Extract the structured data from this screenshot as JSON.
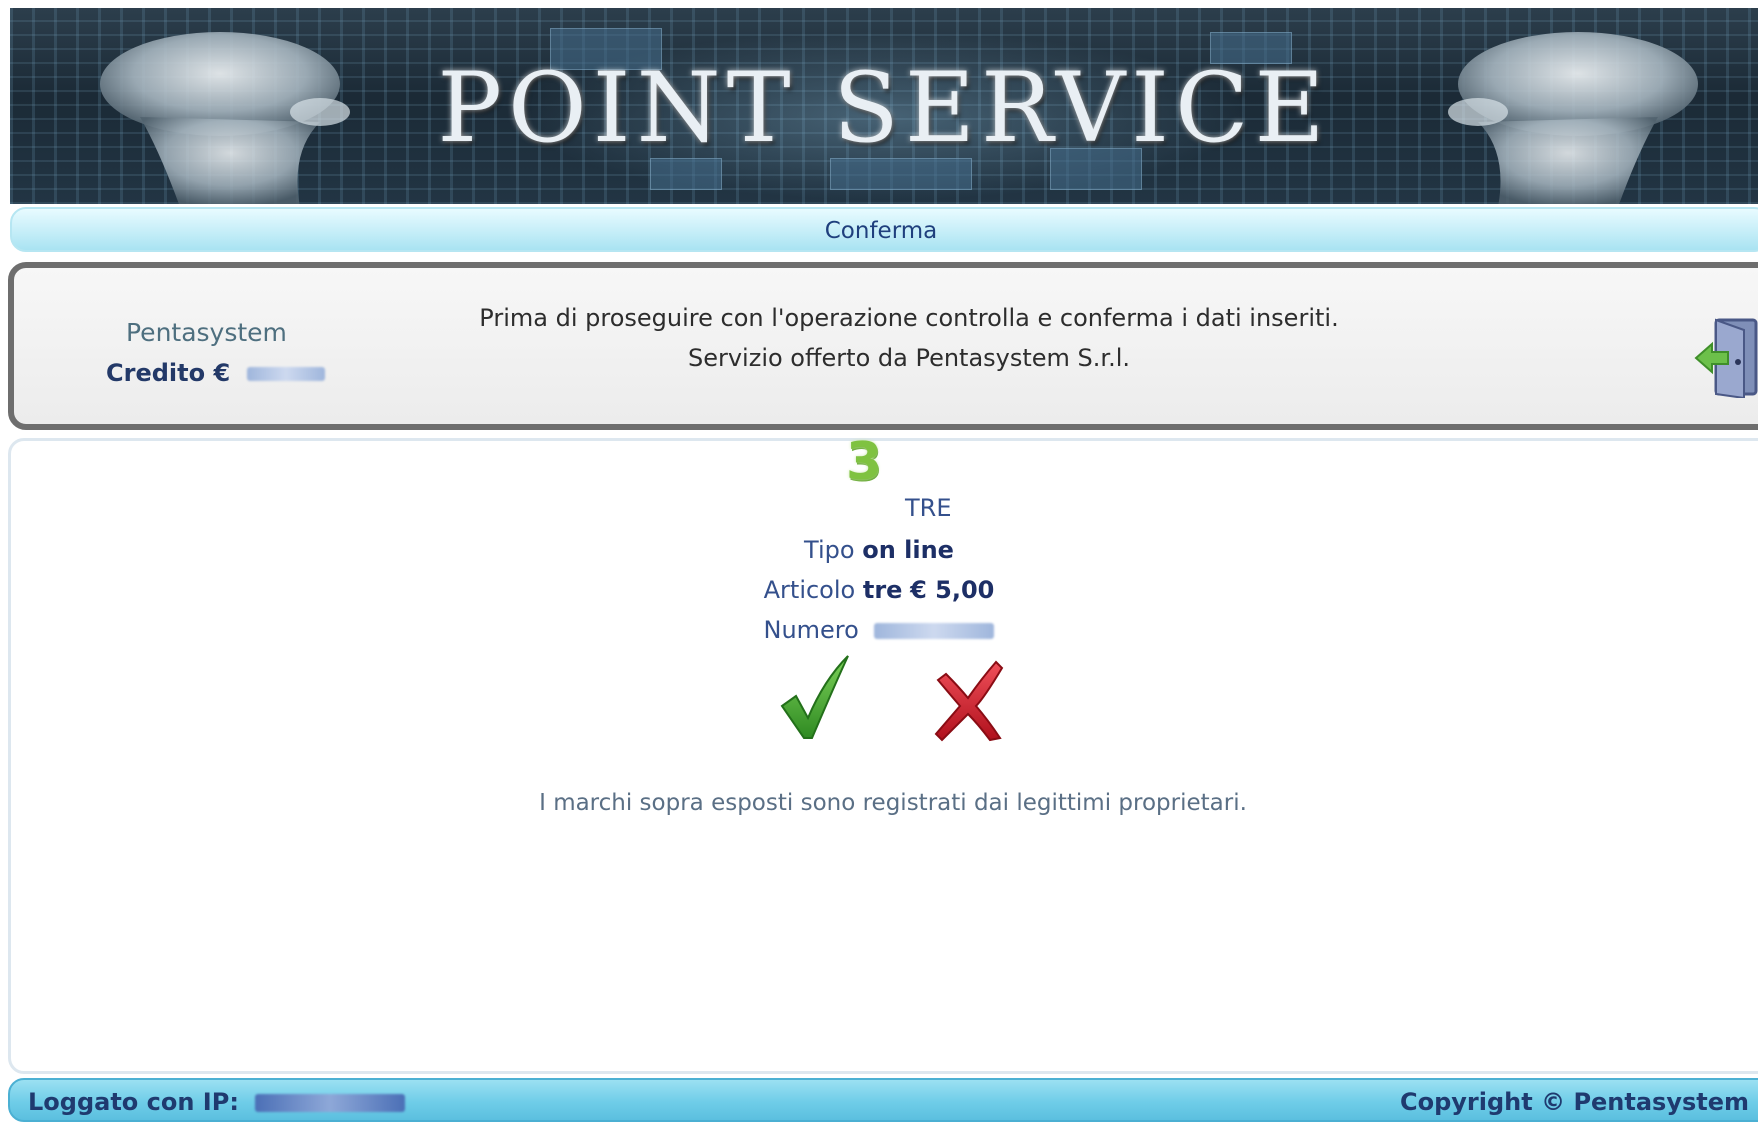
{
  "banner": {
    "title": "POINT SERVICE"
  },
  "title_bar": {
    "label": "Conferma"
  },
  "info": {
    "brand": "Pentasystem",
    "credit_label": "Credito €",
    "message_line1": "Prima di proseguire con l'operazione controlla e conferma i dati inseriti.",
    "message_line2": "Servizio offerto da Pentasystem S.r.l.",
    "logout_icon": "logout-door-icon"
  },
  "operator": {
    "logo_text": "3",
    "name": "TRE"
  },
  "details": {
    "tipo_label": "Tipo",
    "tipo_value": "on line",
    "articolo_label": "Articolo",
    "articolo_value": "tre",
    "articolo_price": "€ 5,00",
    "numero_label": "Numero"
  },
  "actions": {
    "confirm_icon": "green-check-icon",
    "cancel_icon": "red-x-icon"
  },
  "disclaimer": "I marchi sopra esposti sono registrati dai legittimi proprietari.",
  "footer": {
    "ip_label": "Loggato con IP:",
    "copyright": "Copyright © Pentasystem S.r.l."
  },
  "colors": {
    "accent": "#1f3a6f",
    "title_bar": "#c6eef8",
    "footer": "#6fcde8",
    "confirm": "#3a9a2a",
    "cancel": "#d0202a"
  }
}
